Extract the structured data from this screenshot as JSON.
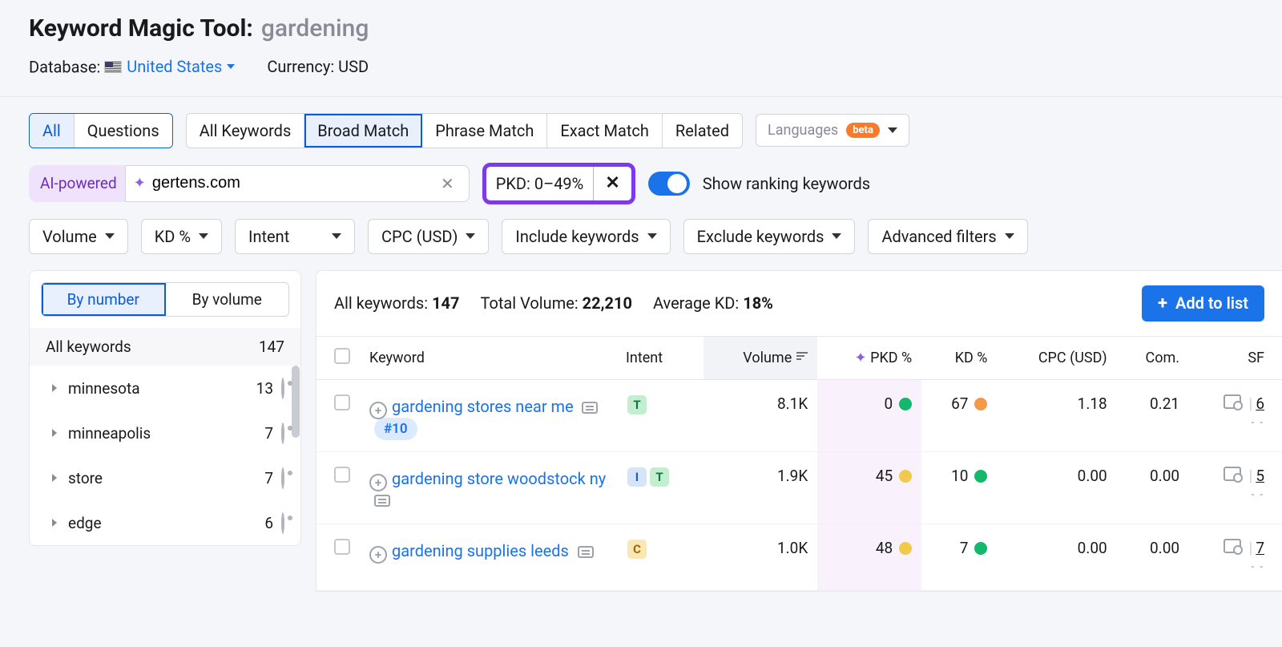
{
  "header": {
    "tool_name": "Keyword Magic Tool:",
    "query": "gardening",
    "db_label": "Database:",
    "db_value": "United States",
    "currency_label": "Currency:",
    "currency_value": "USD"
  },
  "tabs1": {
    "all": "All",
    "questions": "Questions"
  },
  "tabs2": {
    "allkw": "All Keywords",
    "broad": "Broad Match",
    "phrase": "Phrase Match",
    "exact": "Exact Match",
    "related": "Related"
  },
  "languages": {
    "label": "Languages",
    "badge": "beta"
  },
  "ai": {
    "label": "AI-powered",
    "domain_value": "gertens.com"
  },
  "pkd_chip": "PKD: 0–49%",
  "show_ranking": "Show ranking keywords",
  "filters": {
    "volume": "Volume",
    "kd": "KD %",
    "intent": "Intent",
    "cpc": "CPC (USD)",
    "include": "Include keywords",
    "exclude": "Exclude keywords",
    "advanced": "Advanced filters"
  },
  "sidebar": {
    "by_number": "By number",
    "by_volume": "By volume",
    "allkw_label": "All keywords",
    "allkw_count": "147",
    "items": [
      {
        "label": "minnesota",
        "count": "13"
      },
      {
        "label": "minneapolis",
        "count": "7"
      },
      {
        "label": "store",
        "count": "7"
      },
      {
        "label": "edge",
        "count": "6"
      }
    ]
  },
  "summary": {
    "allkw_label": "All keywords:",
    "allkw_val": "147",
    "vol_label": "Total Volume:",
    "vol_val": "22,210",
    "kd_label": "Average KD:",
    "kd_val": "18%",
    "add_btn": "Add to list"
  },
  "columns": {
    "keyword": "Keyword",
    "intent": "Intent",
    "volume": "Volume",
    "pkd": "PKD %",
    "kd": "KD %",
    "cpc": "CPC (USD)",
    "com": "Com.",
    "sf": "SF"
  },
  "rows": [
    {
      "kw": "gardening stores near me",
      "rank": "#10",
      "intents": [
        "T"
      ],
      "volume": "8.1K",
      "pkd": "0",
      "pkd_color": "g",
      "kd": "67",
      "kd_color": "o",
      "cpc": "1.18",
      "com": "0.21",
      "sf": "6"
    },
    {
      "kw": "gardening store woodstock ny",
      "rank": "",
      "intents": [
        "I",
        "T"
      ],
      "volume": "1.9K",
      "pkd": "45",
      "pkd_color": "y",
      "kd": "10",
      "kd_color": "g",
      "cpc": "0.00",
      "com": "0.00",
      "sf": "5"
    },
    {
      "kw": "gardening supplies leeds",
      "rank": "",
      "intents": [
        "C"
      ],
      "volume": "1.0K",
      "pkd": "48",
      "pkd_color": "y",
      "kd": "7",
      "kd_color": "g",
      "cpc": "0.00",
      "com": "0.00",
      "sf": "7"
    }
  ]
}
